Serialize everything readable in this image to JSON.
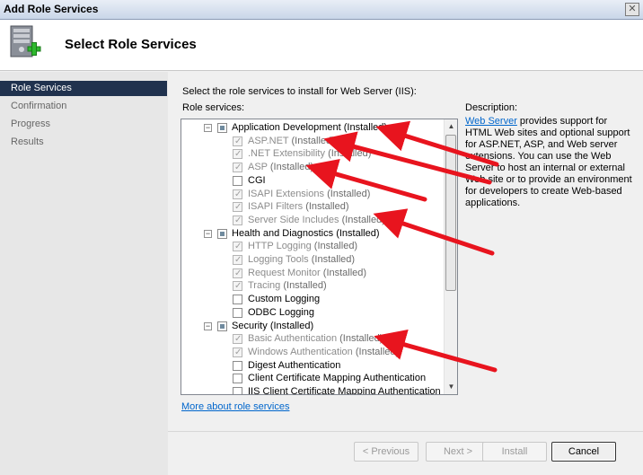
{
  "window": {
    "title": "Add Role Services",
    "close_glyph": "✕"
  },
  "header": {
    "page_title": "Select Role Services",
    "icon": "server-add-icon"
  },
  "sidebar": {
    "items": [
      {
        "label": "Role Services",
        "active": true
      },
      {
        "label": "Confirmation",
        "active": false
      },
      {
        "label": "Progress",
        "active": false
      },
      {
        "label": "Results",
        "active": false
      }
    ]
  },
  "main": {
    "instruction": "Select the role services to install for Web Server (IIS):",
    "role_services_label": "Role services:",
    "description_label": "Description:",
    "description_link": "Web Server",
    "description_text": " provides support for HTML Web sites and optional support for ASP.NET, ASP, and Web server extensions. You can use the Web Server to host an internal or external Web site or to provide an environment for developers to create Web-based applications.",
    "more_link": "More about role services"
  },
  "tree": [
    {
      "label": "Application Development",
      "status": "(Installed)",
      "level": 0,
      "state": "partial",
      "disabled": false
    },
    {
      "label": "ASP.NET",
      "status": "(Installed)",
      "level": 1,
      "state": "checked",
      "disabled": true
    },
    {
      "label": ".NET Extensibility",
      "status": "(Installed)",
      "level": 1,
      "state": "checked",
      "disabled": true
    },
    {
      "label": "ASP",
      "status": "(Installed)",
      "level": 1,
      "state": "checked",
      "disabled": true
    },
    {
      "label": "CGI",
      "status": "",
      "level": 1,
      "state": "unchecked",
      "disabled": false
    },
    {
      "label": "ISAPI Extensions",
      "status": "(Installed)",
      "level": 1,
      "state": "checked",
      "disabled": true
    },
    {
      "label": "ISAPI Filters",
      "status": "(Installed)",
      "level": 1,
      "state": "checked",
      "disabled": true
    },
    {
      "label": "Server Side Includes",
      "status": "(Installed)",
      "level": 1,
      "state": "checked",
      "disabled": true
    },
    {
      "label": "Health and Diagnostics",
      "status": "(Installed)",
      "level": 0,
      "state": "partial",
      "disabled": false
    },
    {
      "label": "HTTP Logging",
      "status": "(Installed)",
      "level": 1,
      "state": "checked",
      "disabled": true
    },
    {
      "label": "Logging Tools",
      "status": "(Installed)",
      "level": 1,
      "state": "checked",
      "disabled": true
    },
    {
      "label": "Request Monitor",
      "status": "(Installed)",
      "level": 1,
      "state": "checked",
      "disabled": true
    },
    {
      "label": "Tracing",
      "status": "(Installed)",
      "level": 1,
      "state": "checked",
      "disabled": true
    },
    {
      "label": "Custom Logging",
      "status": "",
      "level": 1,
      "state": "unchecked",
      "disabled": false
    },
    {
      "label": "ODBC Logging",
      "status": "",
      "level": 1,
      "state": "unchecked",
      "disabled": false
    },
    {
      "label": "Security",
      "status": "(Installed)",
      "level": 0,
      "state": "partial",
      "disabled": false
    },
    {
      "label": "Basic Authentication",
      "status": "(Installed)",
      "level": 1,
      "state": "checked",
      "disabled": true
    },
    {
      "label": "Windows Authentication",
      "status": "(Installed)",
      "level": 1,
      "state": "checked",
      "disabled": true
    },
    {
      "label": "Digest Authentication",
      "status": "",
      "level": 1,
      "state": "unchecked",
      "disabled": false
    },
    {
      "label": "Client Certificate Mapping Authentication",
      "status": "",
      "level": 1,
      "state": "unchecked",
      "disabled": false
    },
    {
      "label": "IIS Client Certificate Mapping Authentication",
      "status": "",
      "level": 1,
      "state": "unchecked",
      "disabled": false
    }
  ],
  "scrollbar": {
    "up_glyph": "▲",
    "down_glyph": "▼"
  },
  "buttons": {
    "previous": "< Previous",
    "next": "Next >",
    "install": "Install",
    "cancel": "Cancel"
  },
  "colors": {
    "annotation_arrow": "#e8141e",
    "selection": "#20324e",
    "link": "#0066cc"
  }
}
